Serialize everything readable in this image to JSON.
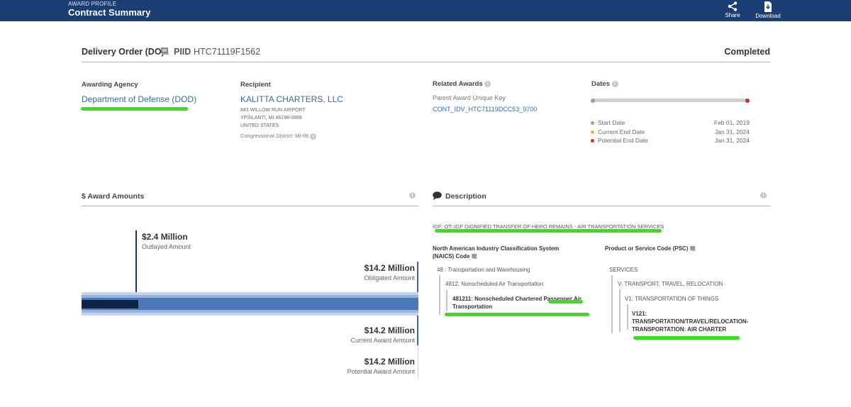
{
  "header": {
    "eyebrow": "AWARD PROFILE",
    "title": "Contract Summary",
    "share_label": "Share",
    "download_label": "Download"
  },
  "award": {
    "type": "Delivery Order (DO)",
    "piid_label": "PIID",
    "piid": "HTC71119F1562",
    "status": "Completed"
  },
  "agency": {
    "label": "Awarding Agency",
    "name": "Department of Defense (DOD)"
  },
  "recipient": {
    "label": "Recipient",
    "name": "KALITTA CHARTERS, LLC",
    "address1": "843 WILLOW RUN AIRPORT",
    "address2": "YPSILANTI, MI 48198-0899",
    "country": "UNITED STATES",
    "district": "Congressional District: MI-06"
  },
  "related": {
    "label": "Related Awards",
    "parent_label": "Parent Award Unique Key",
    "parent_value": "CONT_IDV_HTC71119DCC53_9700"
  },
  "dates": {
    "label": "Dates",
    "progress": 1.0,
    "rows": [
      {
        "label": "Start Date",
        "value": "Feb 01, 2019",
        "color": "#6fbf73"
      },
      {
        "label": "Current End Date",
        "value": "Jan 31, 2024",
        "color": "#f0b429"
      },
      {
        "label": "Potential End Date",
        "value": "Jan 31, 2024",
        "color": "#d0312d"
      }
    ]
  },
  "amounts": {
    "label": "$ Award Amounts",
    "outlayed": {
      "value": "$2.4 Million",
      "label": "Outlayed Amount"
    },
    "obligated": {
      "value": "$14.2 Million",
      "label": "Obligated Amount"
    },
    "current": {
      "value": "$14.2 Million",
      "label": "Current Award Amount"
    },
    "potential": {
      "value": "$14.2 Million",
      "label": "Potential Award Amount"
    },
    "outlay_fraction": 0.169
  },
  "description": {
    "label": "Description",
    "text": "IGF::OT::IGF DIGNIFIED TRANSFER OF HERO REMAINS - AIR TRANSPORTATION SERVICES",
    "naics_label_1": "North American Industry Classification System",
    "naics_label_2": "(NAICS)  Code",
    "naics_l1": "48 : Transportation and Warehousing",
    "naics_l2": "4812: Nonscheduled Air Transportation",
    "naics_l3a": "481211: Nonscheduled Chartered Passenger Air",
    "naics_l3b": "Transportation",
    "psc_label": "Product or Service Code (PSC)",
    "psc_l1": "SERVICES",
    "psc_l2": "V: TRANSPORT, TRAVEL, RELOCATION",
    "psc_l3": "V1: TRANSPORTATION OF THINGS",
    "psc_l4a": "V121:",
    "psc_l4b": "TRANSPORTATION/TRAVEL/RELOCATION-",
    "psc_l4c": "TRANSPORTATION: AIR CHARTER"
  },
  "colors": {
    "header": "#1c3f73",
    "link": "#2c6cb0",
    "highlight": "#39e01a"
  }
}
